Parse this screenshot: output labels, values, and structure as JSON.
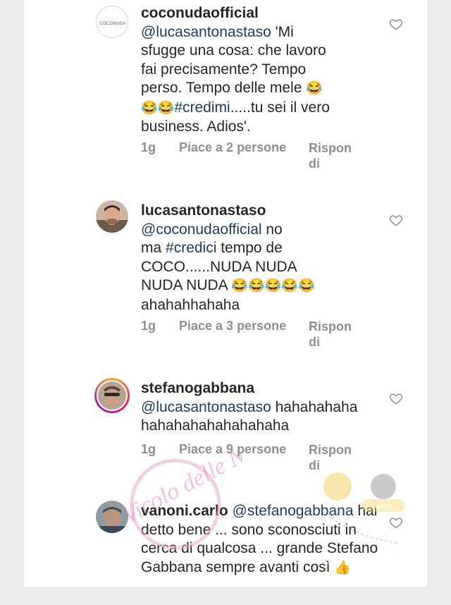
{
  "comments": [
    {
      "username": "coconudaofficial",
      "avatar_text": "COCONUDA",
      "lines": [
        [
          {
            "t": "mention",
            "v": "@lucasantonastaso"
          },
          {
            "t": "text",
            "v": " 'Mi"
          }
        ],
        [
          {
            "t": "text",
            "v": "sfugge una cosa: che lavoro"
          }
        ],
        [
          {
            "t": "text",
            "v": "fai precisamente? Tempo"
          }
        ],
        [
          {
            "t": "text",
            "v": "perso. Tempo delle mele "
          },
          {
            "t": "emoji",
            "v": "😂"
          }
        ],
        [
          {
            "t": "emoji",
            "v": "😂😂"
          },
          {
            "t": "tag",
            "v": "#credimi"
          },
          {
            "t": "text",
            "v": ".....tu sei il vero"
          }
        ],
        [
          {
            "t": "text",
            "v": "business. Adios'."
          }
        ]
      ],
      "time": "1g",
      "likes": "Piace a 2 persone",
      "reply": "Rispon di"
    },
    {
      "username": "lucasantonastaso",
      "lines": [
        [
          {
            "t": "mention",
            "v": "@coconudaofficial"
          },
          {
            "t": "text",
            "v": " no"
          }
        ],
        [
          {
            "t": "text",
            "v": "ma "
          },
          {
            "t": "tag",
            "v": "#credici"
          },
          {
            "t": "text",
            "v": " tempo de"
          }
        ],
        [
          {
            "t": "text",
            "v": "COCO......NUDA NUDA"
          }
        ],
        [
          {
            "t": "text",
            "v": "NUDA NUDA "
          },
          {
            "t": "emoji",
            "v": "😂😂😂😂😂"
          }
        ],
        [
          {
            "t": "text",
            "v": "ahahahhahaha"
          }
        ]
      ],
      "time": "1g",
      "likes": "Piace a 3 persone",
      "reply": "Rispon di"
    },
    {
      "username": "stefanogabbana",
      "lines": [
        [
          {
            "t": "mention",
            "v": "@lucasantonastaso"
          },
          {
            "t": "text",
            "v": " hahahahaha"
          }
        ],
        [
          {
            "t": "text",
            "v": "hahahahahahahahaha"
          }
        ]
      ],
      "time": "1g",
      "likes": "Piace a 9 persone",
      "reply": "Rispon di"
    },
    {
      "username": "vanoni.carlo",
      "lines": [
        [
          {
            "t": "mention",
            "v": "@stefanogabbana"
          }
        ],
        [
          {
            "t": "text",
            "v": "hai detto bene ... sono"
          }
        ],
        [
          {
            "t": "text",
            "v": "sconosciuti in cerca di"
          }
        ],
        [
          {
            "t": "text",
            "v": "qualcosa ... grande Stefano"
          }
        ],
        [
          {
            "t": "text",
            "v": "Gabbana sempre avanti così "
          },
          {
            "t": "emoji",
            "v": "👍"
          }
        ]
      ]
    }
  ],
  "watermark": {
    "text": "Vicolo delle News",
    "web_text": "web"
  },
  "colors": {
    "mention": "#1f3b5e",
    "meta": "#8e8e8e",
    "username": "#262626",
    "watermark": "#e07ab0"
  }
}
